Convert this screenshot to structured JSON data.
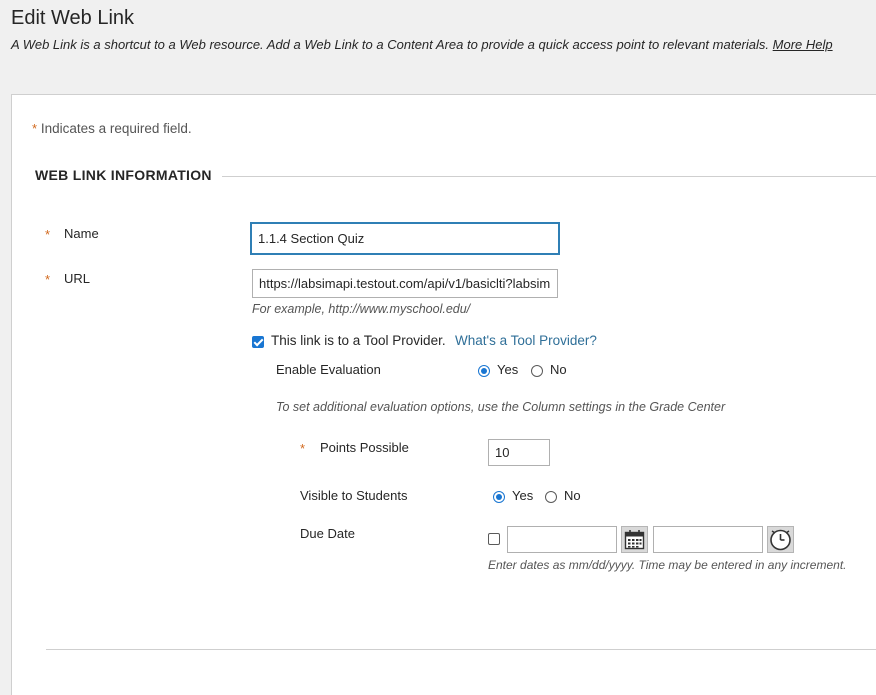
{
  "header": {
    "title": "Edit Web Link",
    "subtitle": "A Web Link is a shortcut to a Web resource. Add a Web Link to a Content Area to provide a quick access point to relevant materials.",
    "help_link": "More Help"
  },
  "form": {
    "required_star": "*",
    "required_note": "Indicates a required field.",
    "section_title": "WEB LINK INFORMATION",
    "name": {
      "label": "Name",
      "value": "1.1.4 Section Quiz"
    },
    "url": {
      "label": "URL",
      "value": "https://labsimapi.testout.com/api/v1/basiclti?labsim",
      "example": "For example, http://www.myschool.edu/"
    },
    "tool_provider": {
      "checked": true,
      "label": "This link is to a Tool Provider.",
      "help_link": "What's a Tool Provider?"
    },
    "enable_evaluation": {
      "label": "Enable Evaluation",
      "yes": "Yes",
      "no": "No",
      "selected": "Yes"
    },
    "evaluation_note": "To set additional evaluation options, use the Column settings in the Grade Center",
    "points_possible": {
      "label": "Points Possible",
      "value": "10"
    },
    "visible_to_students": {
      "label": "Visible to Students",
      "yes": "Yes",
      "no": "No",
      "selected": "Yes"
    },
    "due_date": {
      "label": "Due Date",
      "checked": false,
      "date_value": "",
      "time_value": "",
      "hint": "Enter dates as mm/dd/yyyy. Time may be entered in any increment."
    }
  },
  "icons": {
    "date_picker": "calendar-icon",
    "time_picker": "clock-icon"
  },
  "colors": {
    "accent": "#1976d2",
    "required": "#d2691e",
    "link": "#2f6f98"
  }
}
